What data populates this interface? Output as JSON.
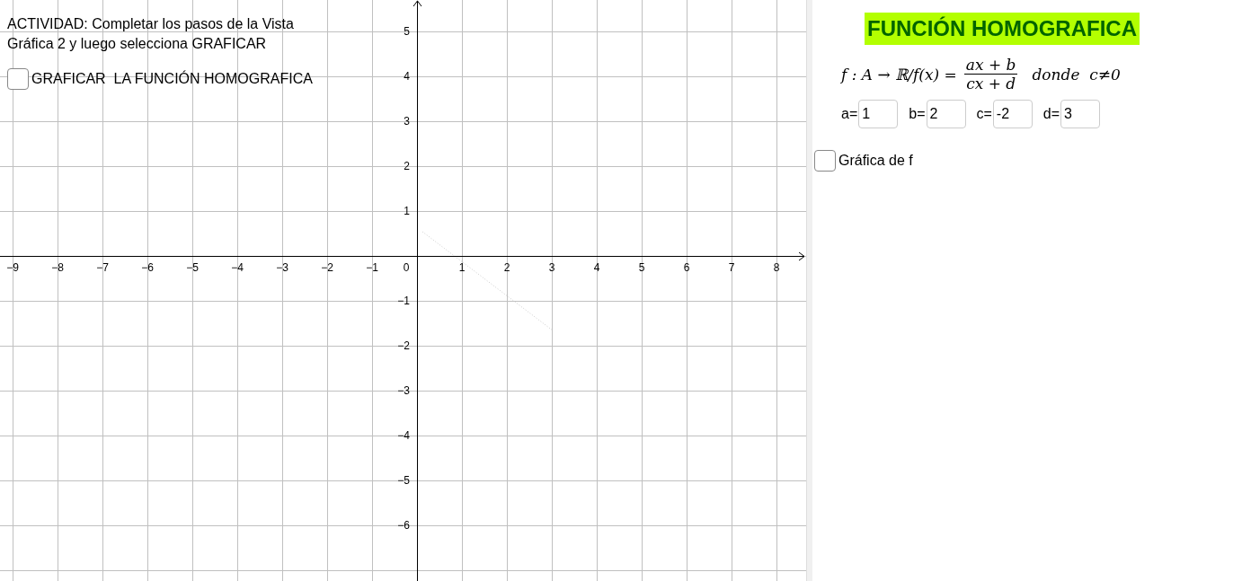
{
  "graph": {
    "x_ticks": [
      "−9",
      "−8",
      "−7",
      "−6",
      "−5",
      "−4",
      "−3",
      "−2",
      "−1",
      "1",
      "2",
      "3",
      "4",
      "5",
      "6",
      "7",
      "8"
    ],
    "origin_label": "0",
    "y_ticks": [
      "5",
      "4",
      "3",
      "2",
      "1",
      "−1",
      "−2",
      "−3",
      "−4",
      "−5",
      "−6"
    ],
    "instructions": [
      "ACTIVIDAD: Completar los pasos de la Vista",
      "Gráfica 2 y luego selecciona GRAFICAR"
    ],
    "checkbox": {
      "label": "GRAFICAR  LA FUNCIÓN HOMOGRAFICA",
      "checked": false
    }
  },
  "panel": {
    "title": "FUNCIÓN HOMOGRAFICA",
    "formula": {
      "lhs": "f : A → ℝ/f(x) =",
      "numerator": "ax + b",
      "denominator": "cx + d",
      "condition": "donde  c≠0"
    },
    "inputs": [
      {
        "label": "a=",
        "value": "1"
      },
      {
        "label": "b=",
        "value": "2"
      },
      {
        "label": "c=",
        "value": "-2"
      },
      {
        "label": "d=",
        "value": "3"
      }
    ],
    "checkbox": {
      "label": "Gráfica de f",
      "checked": false
    }
  }
}
